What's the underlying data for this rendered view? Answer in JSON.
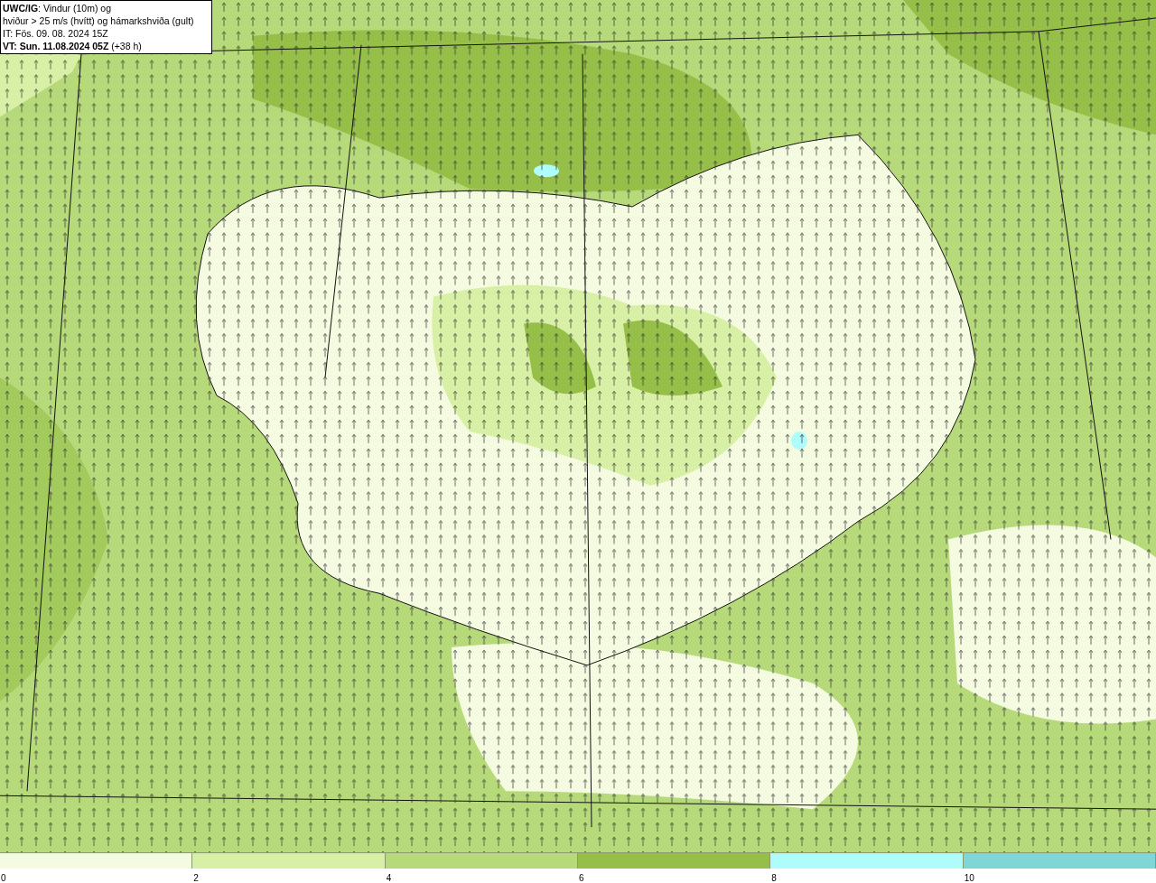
{
  "info_box": {
    "lines": [
      "**UWC/IG**: Vindur (10m) og",
      "hviður > 25 m/s (hvítt) og hámarkshviða (gult)",
      "IT: Fös. 09. 08. 2024 15Z",
      "**VT: Sun. 11.08.2024 05Z** (+38 h)"
    ]
  },
  "legend": {
    "bins": [
      {
        "label": "0",
        "color": "#f4fbe0"
      },
      {
        "label": "2",
        "color": "#d8f0a5"
      },
      {
        "label": "4",
        "color": "#b6d97a"
      },
      {
        "label": "6",
        "color": "#95bf48"
      },
      {
        "label": "8",
        "color": "#aefcfc"
      },
      {
        "label": "10",
        "color": "#7fd6d6"
      }
    ]
  }
}
